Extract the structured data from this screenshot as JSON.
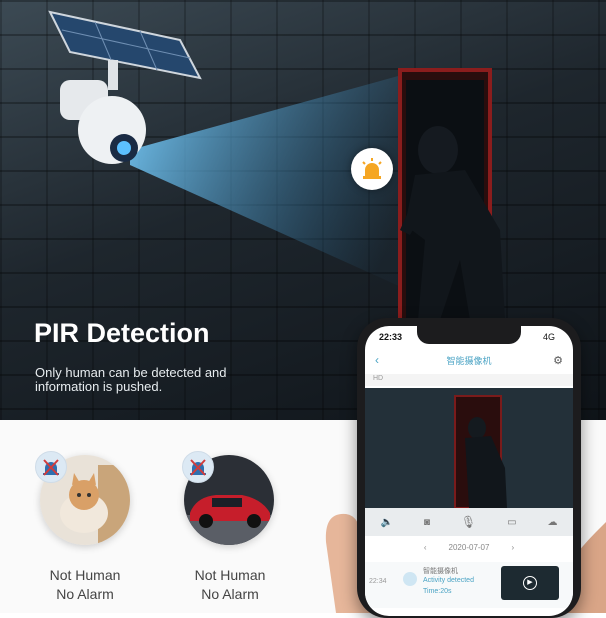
{
  "hero": {
    "title": "PIR Detection",
    "subtitle": "Only human can be detected and information is pushed."
  },
  "cards": [
    {
      "line1": "Not Human",
      "line2": "No Alarm",
      "subject": "cat"
    },
    {
      "line1": "Not Human",
      "line2": "No Alarm",
      "subject": "car"
    }
  ],
  "phone": {
    "time": "22:33",
    "network": "4G",
    "app_title": "智能摄像机",
    "quality": "HD",
    "date": "2020-07-07",
    "event": {
      "time": "22:34",
      "camera": "智能摄像机",
      "text": "Activity detected",
      "duration": "Time:20s"
    }
  },
  "colors": {
    "beam": "#4fb3ff",
    "alarm": "#f5a623",
    "accent": "#4aa3c4"
  }
}
